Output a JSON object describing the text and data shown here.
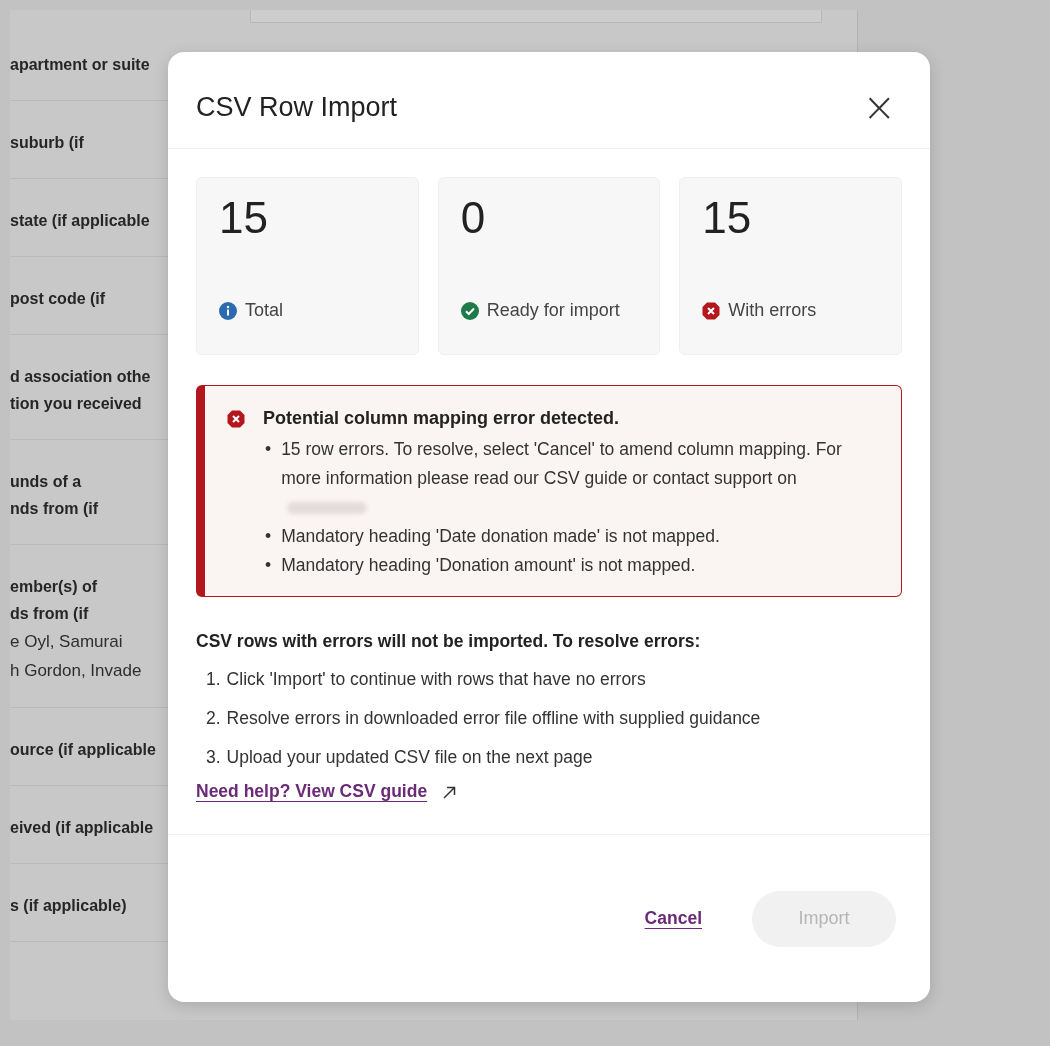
{
  "background_form": {
    "rows": [
      {
        "lines": [
          "apartment or suite"
        ]
      },
      {
        "lines": [
          "suburb (if"
        ]
      },
      {
        "lines": [
          "state (if applicable"
        ]
      },
      {
        "lines": [
          "post code (if"
        ]
      },
      {
        "lines": [
          "d association othe",
          "tion you received"
        ]
      },
      {
        "lines": [
          "unds of a",
          "nds from (if"
        ]
      },
      {
        "lines": [
          "ember(s) of",
          "ds from (if"
        ],
        "value_lines": [
          "e Oyl, Samurai",
          "h Gordon, Invade"
        ]
      },
      {
        "lines": [
          "ource (if applicable"
        ]
      },
      {
        "lines": [
          "eived (if applicable"
        ]
      },
      {
        "lines": [
          "s (if applicable)"
        ]
      }
    ]
  },
  "dialog": {
    "title": "CSV Row Import",
    "close": "×",
    "stats": [
      {
        "value": "15",
        "label": "Total",
        "kind": "info"
      },
      {
        "value": "0",
        "label": "Ready for import",
        "kind": "success"
      },
      {
        "value": "15",
        "label": "With errors",
        "kind": "error"
      }
    ],
    "alert": {
      "title": "Potential column mapping error detected.",
      "bullet": "•",
      "items": [
        "15 row errors. To resolve, select 'Cancel' to amend column mapping. For more information please read our CSV guide or contact support on",
        "Mandatory heading 'Date donation made' is not mapped.",
        "Mandatory heading 'Donation amount' is not mapped."
      ]
    },
    "instructions_heading": "CSV rows with errors will not be imported. To resolve errors:",
    "steps": [
      {
        "number": "1.",
        "text": "Click 'Import' to continue with rows that have no errors"
      },
      {
        "number": "2.",
        "text": "Resolve errors in downloaded error file offline with supplied guidance"
      },
      {
        "number": "3.",
        "text": "Upload your updated CSV file on the next page"
      }
    ],
    "help_link": "Need help? View CSV guide",
    "cancel": "Cancel",
    "import": {
      "label": "Import",
      "disabled": true
    }
  }
}
